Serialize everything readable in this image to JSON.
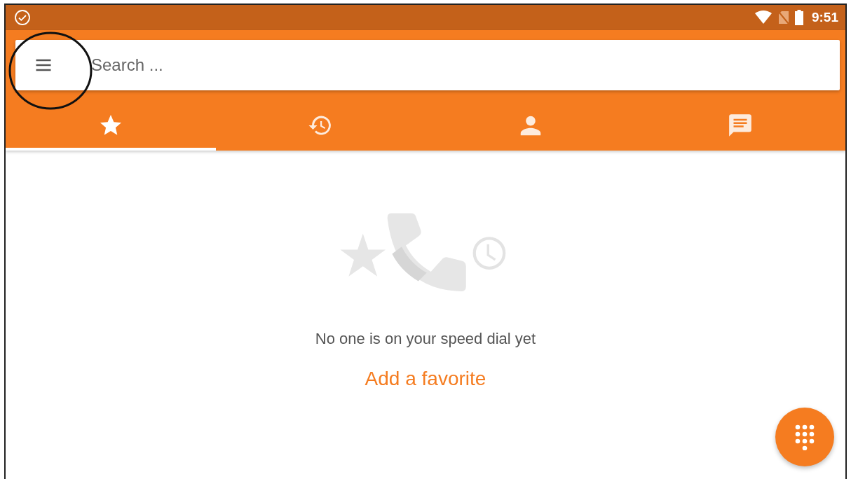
{
  "status_bar": {
    "time": "9:51"
  },
  "search": {
    "placeholder": "Search ..."
  },
  "tabs": [
    {
      "kind": "favorites",
      "selected": true
    },
    {
      "kind": "history",
      "selected": false
    },
    {
      "kind": "contacts",
      "selected": false
    },
    {
      "kind": "messages",
      "selected": false
    }
  ],
  "empty_state": {
    "message": "No one is on your speed dial yet",
    "action": "Add a favorite"
  }
}
